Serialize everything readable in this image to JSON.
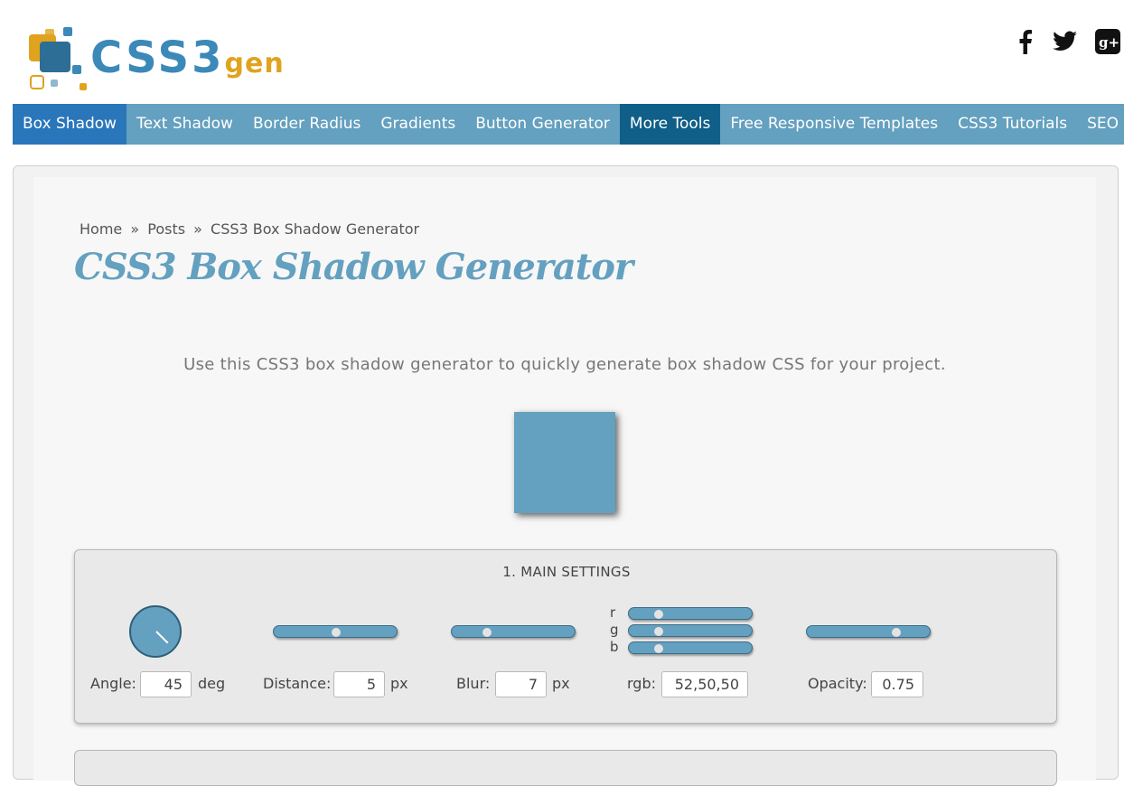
{
  "logo": {
    "word": "CSS3",
    "suffix": "gen"
  },
  "nav": {
    "items": [
      {
        "label": "Box Shadow"
      },
      {
        "label": "Text Shadow"
      },
      {
        "label": "Border Radius"
      },
      {
        "label": "Gradients"
      },
      {
        "label": "Button Generator"
      },
      {
        "label": "More Tools"
      },
      {
        "label": "Free Responsive Templates"
      },
      {
        "label": "CSS3 Tutorials"
      },
      {
        "label": "SEO"
      }
    ]
  },
  "breadcrumb": {
    "home": "Home",
    "sep": "»",
    "posts": "Posts",
    "current": "CSS3 Box Shadow Generator"
  },
  "page": {
    "title": "CSS3 Box Shadow Generator",
    "intro": "Use this CSS3 box shadow generator to quickly generate box shadow CSS for your project."
  },
  "settings": {
    "title": "1. MAIN SETTINGS",
    "angle": {
      "label": "Angle:",
      "value": "45",
      "unit": "deg"
    },
    "distance": {
      "label": "Distance:",
      "value": "5",
      "unit": "px",
      "slider_fraction": 0.5
    },
    "blur": {
      "label": "Blur:",
      "value": "7",
      "unit": "px",
      "slider_fraction": 0.25
    },
    "rgb": {
      "label": "rgb:",
      "value": "52,50,50",
      "r_label": "r",
      "g_label": "g",
      "b_label": "b",
      "r": 52,
      "g": 50,
      "b": 50
    },
    "opacity": {
      "label": "Opacity:",
      "value": "0.75",
      "slider_fraction": 0.75
    }
  },
  "colors": {
    "accent": "#64a0bf",
    "nav_active": "#2a76bb",
    "nav_more": "#0f5f88",
    "logo_blue": "#3b89b8",
    "logo_orange": "#e0a31e"
  }
}
